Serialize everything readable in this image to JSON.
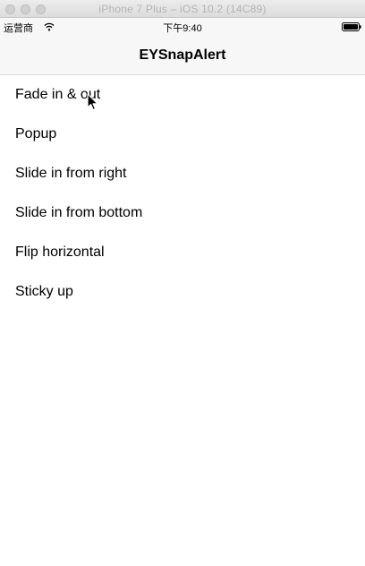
{
  "window": {
    "title": "iPhone 7 Plus – iOS 10.2 (14C89)"
  },
  "status_bar": {
    "carrier": "运营商",
    "wifi_icon": "wifi-icon",
    "time": "下午9:40",
    "battery_icon": "battery-icon"
  },
  "nav": {
    "title": "EYSnapAlert"
  },
  "list": {
    "items": [
      {
        "label": "Fade in & out"
      },
      {
        "label": "Popup"
      },
      {
        "label": "Slide in from right"
      },
      {
        "label": "Slide in from bottom"
      },
      {
        "label": "Flip horizontal"
      },
      {
        "label": "Sticky up"
      }
    ]
  },
  "colors": {
    "nav_background": "#f7f7f7",
    "titlebar_text": "#b3b3b3",
    "text": "#000000"
  }
}
